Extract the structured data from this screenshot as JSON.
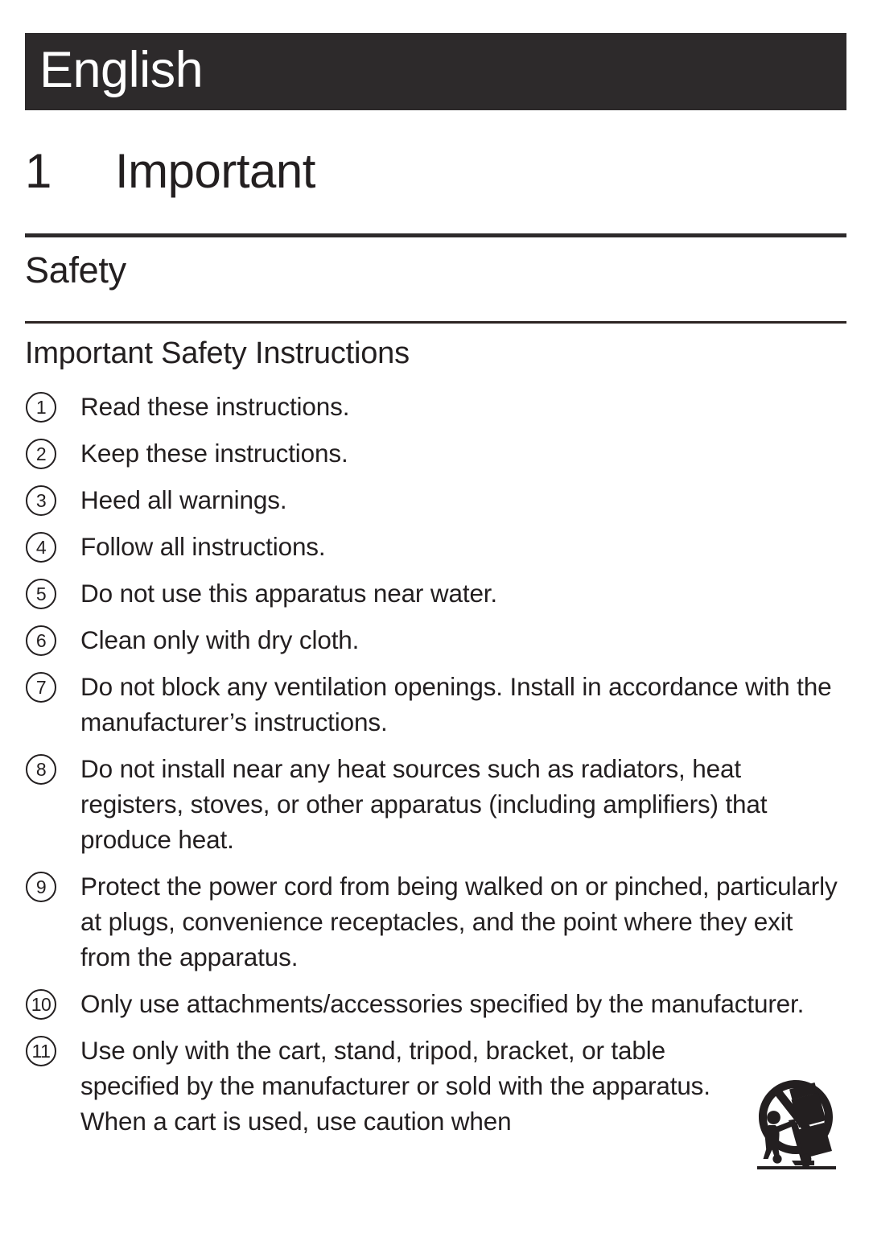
{
  "language_banner": {
    "label": "English",
    "background_color": "#2d2a2b",
    "text_color": "#ffffff"
  },
  "chapter": {
    "number": "1",
    "title": "Important"
  },
  "section": {
    "title": "Safety"
  },
  "subsection": {
    "title": "Important Safety Instructions"
  },
  "instructions": [
    {
      "number": "1",
      "text": "Read these instructions."
    },
    {
      "number": "2",
      "text": "Keep these instructions."
    },
    {
      "number": "3",
      "text": "Heed all warnings."
    },
    {
      "number": "4",
      "text": "Follow all instructions."
    },
    {
      "number": "5",
      "text": "Do not use this apparatus near water."
    },
    {
      "number": "6",
      "text": "Clean only with dry cloth."
    },
    {
      "number": "7",
      "text": "Do not block any ventilation openings. Install in accordance with the manufacturer’s instructions."
    },
    {
      "number": "8",
      "text": "Do not install near any heat sources such as radiators, heat registers, stoves, or other apparatus (including amplifiers) that produce heat."
    },
    {
      "number": "9",
      "text": "Protect the power cord from being walked on or pinched, particularly at plugs, convenience receptacles, and the point where they exit from the apparatus."
    },
    {
      "number": "10",
      "text": "Only use attachments/accessories specified by the manufacturer."
    },
    {
      "number": "11",
      "text": "Use only with the cart, stand, tripod, bracket, or table specified by the manufacturer or sold with the apparatus. When a cart is used, use caution when"
    }
  ],
  "icons": {
    "cart_warning": "no-cart-tipping-warning-icon"
  },
  "colors": {
    "text": "#231f20",
    "rule": "#2d2a2b",
    "page_background": "#ffffff"
  }
}
